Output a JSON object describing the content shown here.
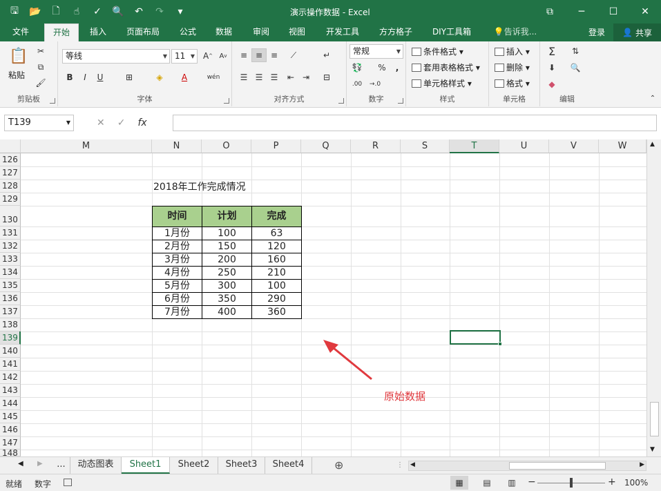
{
  "window": {
    "title": "演示操作数据 - Excel"
  },
  "ribbon_tabs": [
    "文件",
    "开始",
    "插入",
    "页面布局",
    "公式",
    "数据",
    "审阅",
    "视图",
    "开发工具",
    "方方格子",
    "DIY工具箱"
  ],
  "tell_me": "告诉我...",
  "account": {
    "login": "登录",
    "share": "共享"
  },
  "ribbon": {
    "clipboard": {
      "paste": "粘贴",
      "label": "剪贴板"
    },
    "font": {
      "name": "等线",
      "size": "11",
      "label": "字体",
      "bold": "B",
      "italic": "I",
      "underline": "U",
      "phonetic": "wén"
    },
    "align": {
      "label": "对齐方式"
    },
    "number": {
      "format": "常规",
      "percent": "%",
      "comma": ",",
      "label": "数字",
      "increase_decimal": ".00",
      "decrease_decimal": "→.0"
    },
    "styles": {
      "conditional": "条件格式",
      "table": "套用表格格式",
      "cell": "单元格样式",
      "label": "样式"
    },
    "cells": {
      "insert": "插入",
      "delete": "删除",
      "format": "格式",
      "label": "单元格"
    },
    "editing": {
      "label": "编辑"
    }
  },
  "formula_bar": {
    "name_box": "T139",
    "fx": "fx",
    "value": ""
  },
  "columns": [
    "M",
    "N",
    "O",
    "P",
    "Q",
    "R",
    "S",
    "T",
    "U",
    "V",
    "W"
  ],
  "rows": [
    "126",
    "127",
    "128",
    "129",
    "130",
    "131",
    "132",
    "133",
    "134",
    "135",
    "136",
    "137",
    "138",
    "139",
    "140",
    "141",
    "142",
    "143",
    "144",
    "145",
    "146",
    "147",
    "148"
  ],
  "active_cell": {
    "column": "T",
    "row": "139"
  },
  "sheet_title": "2018年工作完成情况",
  "table": {
    "headers": [
      "时间",
      "计划",
      "完成"
    ],
    "rows": [
      [
        "1月份",
        "100",
        "63"
      ],
      [
        "2月份",
        "150",
        "120"
      ],
      [
        "3月份",
        "200",
        "160"
      ],
      [
        "4月份",
        "250",
        "210"
      ],
      [
        "5月份",
        "300",
        "100"
      ],
      [
        "6月份",
        "350",
        "290"
      ],
      [
        "7月份",
        "400",
        "360"
      ]
    ]
  },
  "annotation": "原始数据",
  "sheet_tabs": [
    "动态图表",
    "Sheet1",
    "Sheet2",
    "Sheet3",
    "Sheet4"
  ],
  "active_sheet": "Sheet1",
  "more_sheets": "...",
  "status": {
    "ready": "就绪",
    "numlock": "数字",
    "zoom": "100%"
  },
  "colors": {
    "accent": "#217346",
    "header_fill": "#a9d08e",
    "annotation": "#e0393e"
  }
}
